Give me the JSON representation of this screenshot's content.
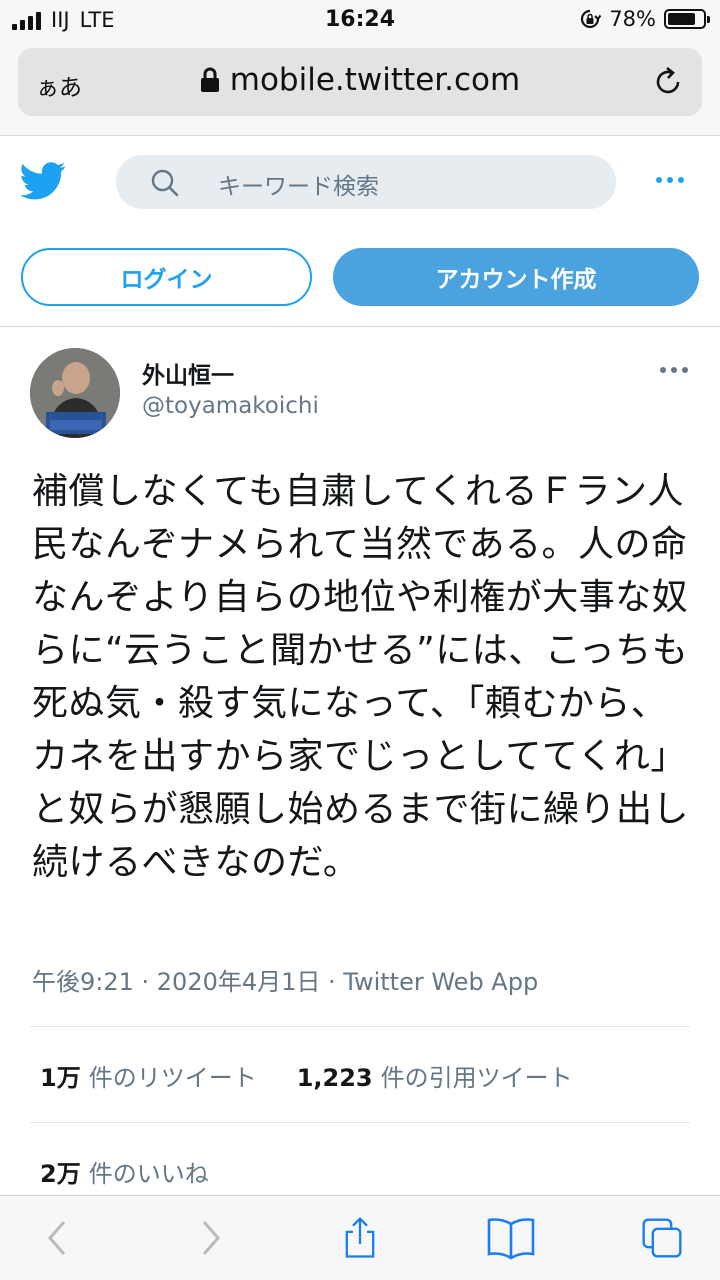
{
  "status_bar": {
    "carrier": "IIJ",
    "network": "LTE",
    "time": "16:24",
    "battery": "78%",
    "battery_level": 0.78
  },
  "browser": {
    "text_size_label": "ぁあ",
    "url": "mobile.twitter.com"
  },
  "header": {
    "search_placeholder": "キーワード検索",
    "login_label": "ログイン",
    "signup_label": "アカウント作成"
  },
  "tweet": {
    "author_name": "外山恒一",
    "author_handle": "@toyamakoichi",
    "text": "補償しなくても自粛してくれるＦラン人民なんぞナメられて当然である。人の命なんぞより自らの地位や利権が大事な奴らに“云うこと聞かせる”には、こっちも死ぬ気・殺す気になって、「頼むから、カネを出すから家でじっとしててくれ」と奴らが懇願し始めるまで街に繰り出し続けるべきなのだ。",
    "meta": "午後9:21 · 2020年4月1日 · Twitter Web App",
    "retweets_count": "1万",
    "retweets_label": "件のリツイート",
    "quotes_count": "1,223",
    "quotes_label": "件の引用ツイート",
    "likes_count": "2万",
    "likes_label": "件のいいね"
  },
  "colors": {
    "twitter_blue": "#1da1f2",
    "signup_bg": "#4aa3df",
    "secondary_text": "#657786"
  }
}
